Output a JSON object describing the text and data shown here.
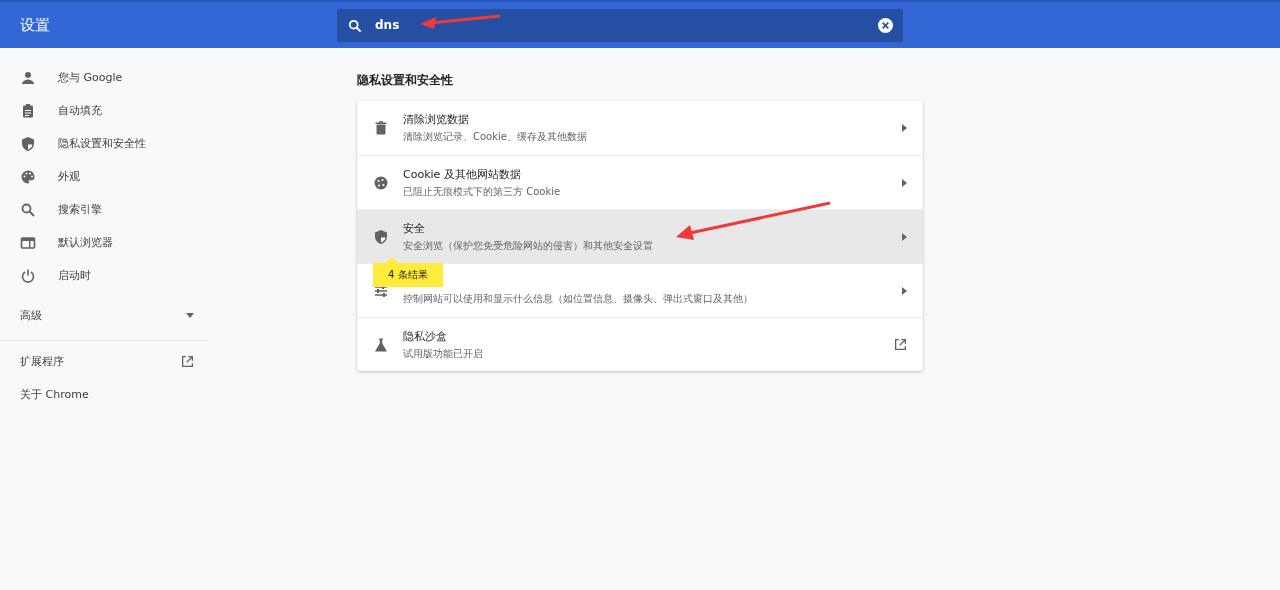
{
  "header": {
    "title": "设置"
  },
  "search": {
    "value": "dns"
  },
  "sidebar": {
    "items": [
      {
        "label": "您与 Google"
      },
      {
        "label": "自动填充"
      },
      {
        "label": "隐私设置和安全性"
      },
      {
        "label": "外观"
      },
      {
        "label": "搜索引擎"
      },
      {
        "label": "默认浏览器"
      },
      {
        "label": "启动时"
      }
    ],
    "advanced": {
      "label": "高级",
      "expanded": false
    },
    "links": [
      {
        "label": "扩展程序",
        "external": true
      },
      {
        "label": "关于 Chrome",
        "external": false
      }
    ]
  },
  "section": {
    "title": "隐私设置和安全性",
    "rows": [
      {
        "title": "清除浏览数据",
        "subtitle": "清除浏览记录、Cookie、缓存及其他数据",
        "kind": "subpage",
        "highlighted": false
      },
      {
        "title": "Cookie 及其他网站数据",
        "subtitle": "已阻止无痕模式下的第三方 Cookie",
        "kind": "subpage",
        "highlighted": false
      },
      {
        "title": "安全",
        "subtitle": "安全浏览（保护您免受危险网站的侵害）和其他安全设置",
        "kind": "subpage",
        "highlighted": true
      },
      {
        "subtitle": "控制网站可以使用和显示什么信息（如位置信息、摄像头、弹出式窗口及其他）",
        "kind": "subpage",
        "highlighted": false
      },
      {
        "title": "隐私沙盒",
        "subtitle": "试用版功能已开启",
        "kind": "external",
        "highlighted": false
      }
    ]
  },
  "results_bubble": {
    "text": "4 条结果"
  },
  "annotations": [
    {
      "kind": "arrow"
    },
    {
      "kind": "arrow"
    }
  ]
}
